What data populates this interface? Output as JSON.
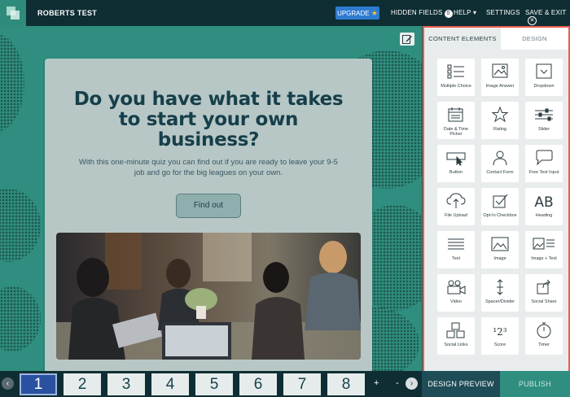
{
  "topbar": {
    "project_title": "ROBERTS TEST",
    "upgrade_label": "UPGRADE",
    "hidden_fields_label": "HIDDEN FIELDS",
    "hidden_fields_count": "0",
    "help_label": "HELP ▾",
    "settings_label": "SETTINGS",
    "save_exit_label": "SAVE & EXIT"
  },
  "card": {
    "headline": "Do you have what it takes to start your own business?",
    "subtext": "With this one-minute quiz you can find out if you are ready to leave your 9-5 job and go for the big leagues on your own.",
    "button_label": "Find out"
  },
  "panel": {
    "tab_content": "CONTENT ELEMENTS",
    "tab_design": "DESIGN",
    "elements": [
      {
        "label": "Multiple Choice",
        "icon": "multiple-choice-icon"
      },
      {
        "label": "Image Answer",
        "icon": "image-answer-icon"
      },
      {
        "label": "Dropdown",
        "icon": "dropdown-icon"
      },
      {
        "label": "Date & Time Picker",
        "icon": "calendar-icon"
      },
      {
        "label": "Rating",
        "icon": "star-icon"
      },
      {
        "label": "Slider",
        "icon": "slider-icon"
      },
      {
        "label": "Button",
        "icon": "button-icon"
      },
      {
        "label": "Contact Form",
        "icon": "contact-form-icon"
      },
      {
        "label": "Free Text Input",
        "icon": "speech-bubble-icon"
      },
      {
        "label": "File Upload",
        "icon": "cloud-upload-icon"
      },
      {
        "label": "Opt-In Checkbox",
        "icon": "checkbox-icon"
      },
      {
        "label": "Heading",
        "icon": "heading-icon"
      },
      {
        "label": "Text",
        "icon": "text-lines-icon"
      },
      {
        "label": "Image",
        "icon": "image-icon"
      },
      {
        "label": "Image + Text",
        "icon": "image-text-icon"
      },
      {
        "label": "Video",
        "icon": "video-camera-icon"
      },
      {
        "label": "Spacer/Divider",
        "icon": "spacer-icon"
      },
      {
        "label": "Social Share",
        "icon": "share-icon"
      },
      {
        "label": "Social Links",
        "icon": "social-links-icon"
      },
      {
        "label": "Score",
        "icon": "score-icon"
      },
      {
        "label": "Timer",
        "icon": "stopwatch-icon"
      }
    ]
  },
  "bottombar": {
    "pages": [
      "1",
      "2",
      "3",
      "4",
      "5",
      "6",
      "7",
      "8"
    ],
    "active_page": "1",
    "plus": "+",
    "minus": "-",
    "design_preview_label": "DESIGN PREVIEW",
    "publish_label": "PUBLISH"
  },
  "colors": {
    "topbar": "#0f2e33",
    "canvas": "#2f8e7f",
    "card": "#b7c7c6",
    "headline": "#163f4a",
    "panel_border": "#ea5d4f",
    "upgrade": "#2e7bd1",
    "active_page": "#2a50a0"
  }
}
